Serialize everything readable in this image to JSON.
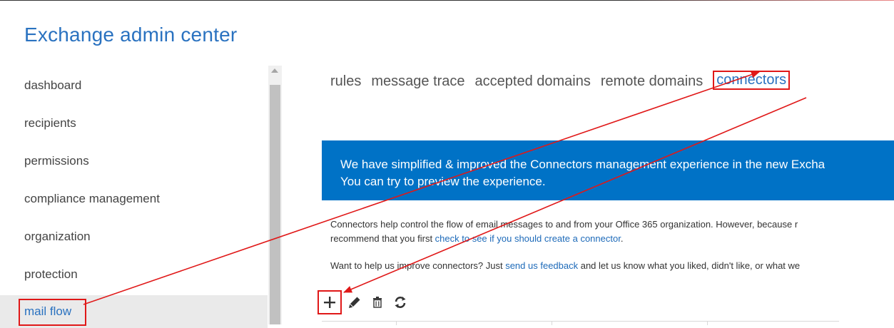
{
  "app": {
    "title": "Exchange admin center"
  },
  "sidebar": {
    "items": [
      {
        "label": "dashboard"
      },
      {
        "label": "recipients"
      },
      {
        "label": "permissions"
      },
      {
        "label": "compliance management"
      },
      {
        "label": "organization"
      },
      {
        "label": "protection"
      },
      {
        "label": "mail flow",
        "selected": true
      }
    ]
  },
  "tabs": [
    {
      "label": "rules"
    },
    {
      "label": "message trace"
    },
    {
      "label": "accepted domains"
    },
    {
      "label": "remote domains"
    },
    {
      "label": "connectors",
      "active": true
    }
  ],
  "banner": {
    "line1": "We have simplified & improved the Connectors management experience in the new Excha",
    "line2": "You can try to preview the experience."
  },
  "description": {
    "line1": "Connectors help control the flow of email messages to and from your Office 365 organization. However, because r",
    "line2_prefix": "recommend that you first ",
    "line2_link": "check to see if you should create a connector",
    "line2_suffix": "."
  },
  "feedback": {
    "prefix": "Want to help us improve connectors? Just ",
    "link": "send us feedback",
    "suffix": " and let us know what you liked, didn't like, or what we"
  },
  "toolbar": {
    "icons": [
      "add-icon",
      "edit-icon",
      "delete-icon",
      "refresh-icon"
    ]
  },
  "colors": {
    "accent": "#2a72c0",
    "banner": "#0072c6",
    "annotation": "#e01818",
    "selected_bg": "#eaeaea"
  }
}
